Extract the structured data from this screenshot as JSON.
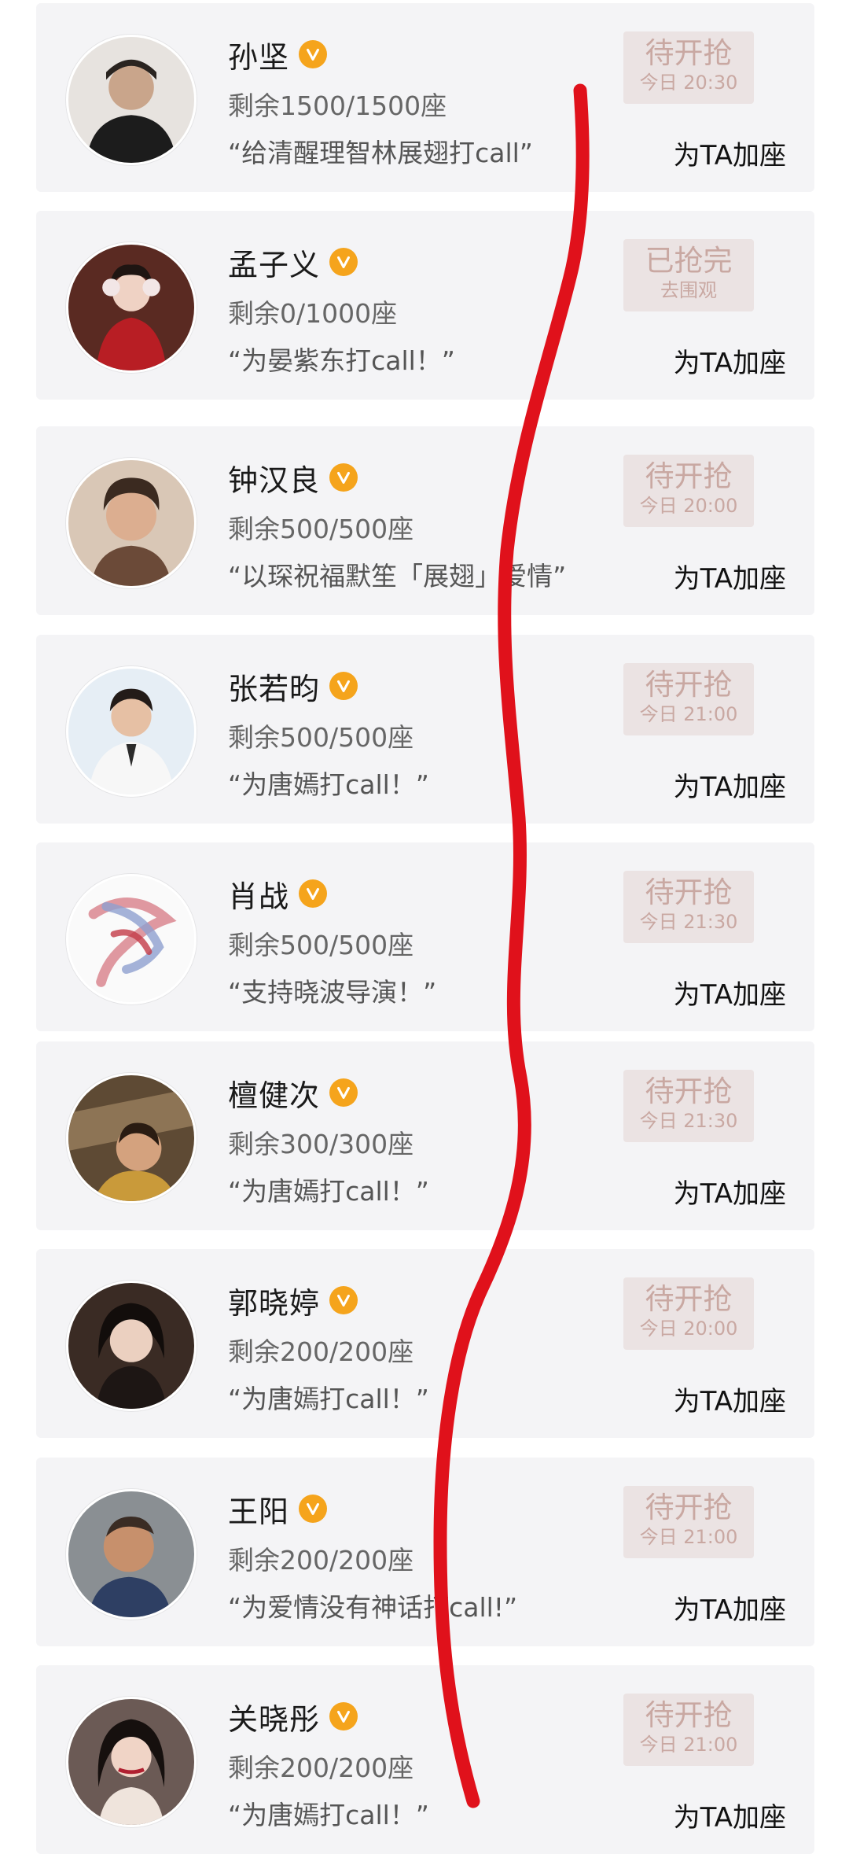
{
  "cards": [
    {
      "name": "孙坚",
      "seats": "剩余1500/1500座",
      "quote": "“给清醒理智林展翅打call”",
      "status_main": "待开抢",
      "status_sub": "今日 20:30",
      "action": "为TA加座",
      "avatar_icon": "person-avatar"
    },
    {
      "name": "孟子义",
      "seats": "剩余0/1000座",
      "quote": "“为晏紫东打call！”",
      "status_main": "已抢完",
      "status_sub": "去围观",
      "action": "为TA加座",
      "avatar_icon": "person-avatar"
    },
    {
      "name": "钟汉良",
      "seats": "剩余500/500座",
      "quote": "“以琛祝福默笙「展翅」爱情”",
      "status_main": "待开抢",
      "status_sub": "今日 20:00",
      "action": "为TA加座",
      "avatar_icon": "person-avatar"
    },
    {
      "name": "张若昀",
      "seats": "剩余500/500座",
      "quote": "“为唐嫣打call！”",
      "status_main": "待开抢",
      "status_sub": "今日 21:00",
      "action": "为TA加座",
      "avatar_icon": "person-avatar"
    },
    {
      "name": "肖战",
      "seats": "剩余500/500座",
      "quote": "“支持晓波导演！”",
      "status_main": "待开抢",
      "status_sub": "今日 21:30",
      "action": "为TA加座",
      "avatar_icon": "brush-art-avatar"
    },
    {
      "name": "檀健次",
      "seats": "剩余300/300座",
      "quote": "“为唐嫣打call！”",
      "status_main": "待开抢",
      "status_sub": "今日 21:30",
      "action": "为TA加座",
      "avatar_icon": "person-avatar"
    },
    {
      "name": "郭晓婷",
      "seats": "剩余200/200座",
      "quote": "“为唐嫣打call！”",
      "status_main": "待开抢",
      "status_sub": "今日 20:00",
      "action": "为TA加座",
      "avatar_icon": "person-avatar"
    },
    {
      "name": "王阳",
      "seats": "剩余200/200座",
      "quote": "“为爱情没有神话打call!”",
      "status_main": "待开抢",
      "status_sub": "今日 21:00",
      "action": "为TA加座",
      "avatar_icon": "person-avatar"
    },
    {
      "name": "关晓彤",
      "seats": "剩余200/200座",
      "quote": "“为唐嫣打call！”",
      "status_main": "待开抢",
      "status_sub": "今日 21:00",
      "action": "为TA加座",
      "avatar_icon": "person-avatar"
    }
  ],
  "colors": {
    "badge": "#f5a41c",
    "status_bg": "#ebe3e3",
    "status_text": "#c9a8a2",
    "scribble": "#e0111b"
  }
}
